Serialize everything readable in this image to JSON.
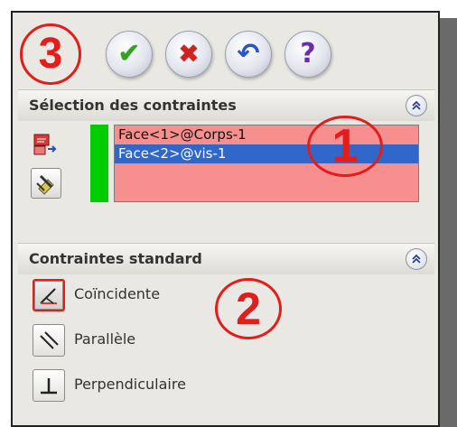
{
  "toolbar": {
    "buttons": [
      {
        "name": "ok",
        "icon": "checkmark-icon",
        "glyph": "✔",
        "color": "#2fa31e"
      },
      {
        "name": "cancel",
        "icon": "cross-icon",
        "glyph": "✖",
        "color": "#d12222"
      },
      {
        "name": "undo",
        "icon": "undo-icon",
        "glyph": "↶",
        "color": "#2a55c4"
      },
      {
        "name": "help",
        "icon": "help-icon",
        "glyph": "?",
        "color": "#6a2fb0"
      }
    ]
  },
  "annotations": {
    "one": "1",
    "two": "2",
    "three": "3",
    "color": "#e21d1d"
  },
  "selection_group": {
    "title": "Sélection des contraintes",
    "items": [
      {
        "label": "Face<1>@Corps-1",
        "selected": false
      },
      {
        "label": "Face<2>@vis-1",
        "selected": true
      }
    ],
    "list_color": "#f78f8f",
    "indicator_color": "#00cc00"
  },
  "standard_group": {
    "title": "Contraintes standard",
    "relations": [
      {
        "label": "Coïncidente",
        "icon": "coincident-icon",
        "active": true
      },
      {
        "label": "Parallèle",
        "icon": "parallel-icon",
        "active": false
      },
      {
        "label": "Perpendiculaire",
        "icon": "perpendicular-icon",
        "active": false
      }
    ]
  }
}
